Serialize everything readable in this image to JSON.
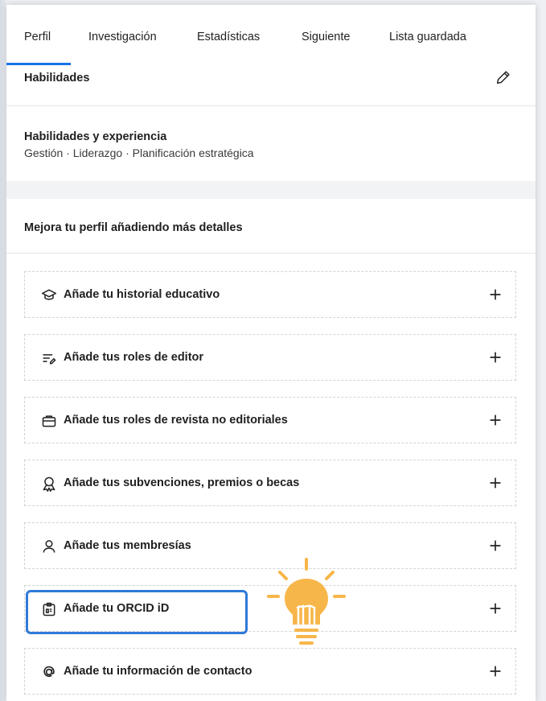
{
  "tabs": [
    {
      "label": "Perfil",
      "active": true
    },
    {
      "label": "Investigación"
    },
    {
      "label": "Estadísticas"
    },
    {
      "label": "Siguiente"
    },
    {
      "label": "Lista guardada"
    }
  ],
  "skills": {
    "title": "Habilidades",
    "subtitle": "Habilidades y experiencia",
    "list": "Gestión · Liderazgo · Planificación estratégica",
    "edit_icon": "pencil-icon"
  },
  "improve": {
    "title": "Mejora tu perfil añadiendo más detalles",
    "items": [
      {
        "label": "Añade tu historial educativo",
        "icon": "graduation-cap-icon"
      },
      {
        "label": "Añade tus roles de editor",
        "icon": "editor-list-icon"
      },
      {
        "label": "Añade tus roles de revista no editoriales",
        "icon": "briefcase-icon"
      },
      {
        "label": "Añade tus subvenciones, premios o becas",
        "icon": "award-ribbon-icon"
      },
      {
        "label": "Añade tus membresías",
        "icon": "person-icon"
      },
      {
        "label": "Añade tu ORCID iD",
        "icon": "id-card-icon",
        "highlighted": true
      },
      {
        "label": "Añade tu información de contacto",
        "icon": "at-sign-icon"
      }
    ],
    "add_icon": "plus-icon"
  },
  "colors": {
    "accent": "#1a73e8",
    "highlight_border": "#2f7ad9",
    "bulb": "#f7b64a"
  }
}
